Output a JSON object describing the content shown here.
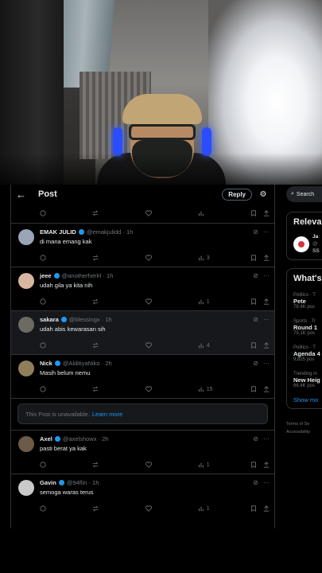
{
  "header": {
    "title": "Post",
    "reply_label": "Reply"
  },
  "tweets": [
    {
      "name": "EMAK JULID",
      "handle": "@emakjulidd · 1h",
      "text": "di mana emang kak",
      "views": "3",
      "avatar_color": "#9aa5b8"
    },
    {
      "name": "jeee",
      "handle": "@anotherherlrl · 1h",
      "text": "udah gila ya kita nih",
      "views": "1",
      "avatar_color": "#d8b7a0"
    },
    {
      "name": "sakara",
      "handle": "@blessingx · 1h",
      "text": "udah abis kewarasan sih",
      "views": "4",
      "avatar_color": "#6d6a63"
    },
    {
      "name": "Nick",
      "handle": "@AlditiyaNiko · 2h",
      "text": "Masih belum nemu",
      "views": "15",
      "avatar_color": "#8f7e5a"
    },
    {
      "name": "Axel",
      "handle": "@axelshowx · 2h",
      "text": "pasti berat ya kak",
      "views": "1",
      "avatar_color": "#6e5a48"
    },
    {
      "name": "Gavin",
      "handle": "@94flin · 1h",
      "text": "semoga waras terus",
      "views": "1",
      "avatar_color": "#c9c9c9"
    }
  ],
  "unavailable": {
    "text": "This Post is unavailable.",
    "link": "Learn more"
  },
  "sidebar": {
    "search": "Search",
    "relevant": {
      "title": "Releva",
      "name": "Ja",
      "handle": "@",
      "extra": "SS"
    },
    "whats": {
      "title": "What's"
    },
    "trends": [
      {
        "meta": "Politics · T",
        "title": "Pete",
        "count": "78.4K pos"
      },
      {
        "meta": "Sports · Tr",
        "title": "Round 1",
        "count": "75.1K pos"
      },
      {
        "meta": "Politics · T",
        "title": "Agenda 4",
        "count": "9,825 pos"
      },
      {
        "meta": "Trending in",
        "title": "New Heig",
        "count": "66.4K pos"
      }
    ],
    "show_more": "Show mo",
    "footer1": "Terms of Se",
    "footer2": "Accessibility"
  }
}
